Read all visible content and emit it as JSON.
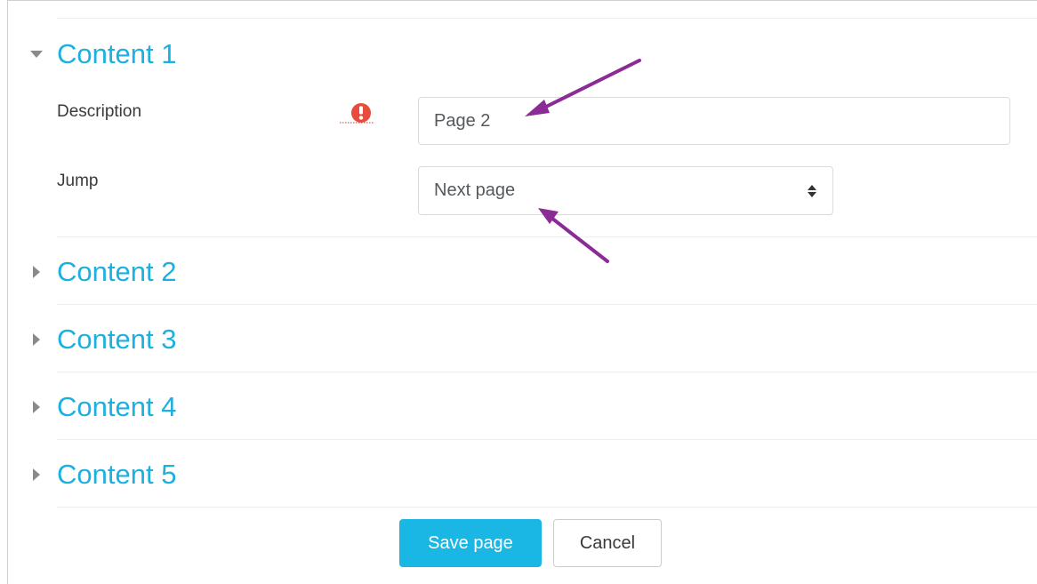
{
  "sections": [
    {
      "title": "Content 1",
      "expanded": true
    },
    {
      "title": "Content 2",
      "expanded": false
    },
    {
      "title": "Content 3",
      "expanded": false
    },
    {
      "title": "Content 4",
      "expanded": false
    },
    {
      "title": "Content 5",
      "expanded": false
    }
  ],
  "form": {
    "description_label": "Description",
    "description_value": "Page 2",
    "jump_label": "Jump",
    "jump_selected": "Next page"
  },
  "buttons": {
    "save_label": "Save page",
    "cancel_label": "Cancel"
  },
  "colors": {
    "accent": "#1cb0e0",
    "primary_button": "#1ab6e4",
    "required_icon": "#e74c3c",
    "annotation_arrow": "#8b2b96"
  },
  "icons": {
    "required": "exclamation-circle-icon",
    "expanded_caret": "caret-down-icon",
    "collapsed_caret": "caret-right-icon",
    "select_arrows": "sort-updown-icon"
  }
}
